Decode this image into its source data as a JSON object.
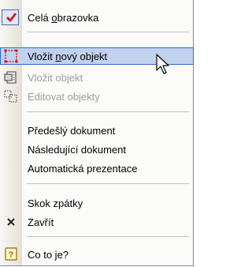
{
  "menu": {
    "items": [
      {
        "label_pre": "Celá ",
        "label_u": "o",
        "label_post": "brazovka",
        "icon": "checkmark-icon"
      },
      {
        "label_pre": "Vložit ",
        "label_u": "n",
        "label_post": "ový objekt",
        "icon": "new-object-icon"
      },
      {
        "label": "Vložit objekt",
        "icon": "insert-object-icon"
      },
      {
        "label": "Editovat objekty",
        "icon": "edit-objects-icon"
      },
      {
        "label": "Předešlý dokument"
      },
      {
        "label": "Následující dokument"
      },
      {
        "label": "Automatická prezentace"
      },
      {
        "label": "Skok zpátky"
      },
      {
        "label": "Zavřít",
        "icon": "close-icon"
      },
      {
        "label": "Co to je?",
        "icon": "help-icon"
      }
    ],
    "colors": {
      "hover_bg": "#c1d2ee",
      "hover_border": "#316ac5",
      "check": "#cc1f1f"
    }
  }
}
